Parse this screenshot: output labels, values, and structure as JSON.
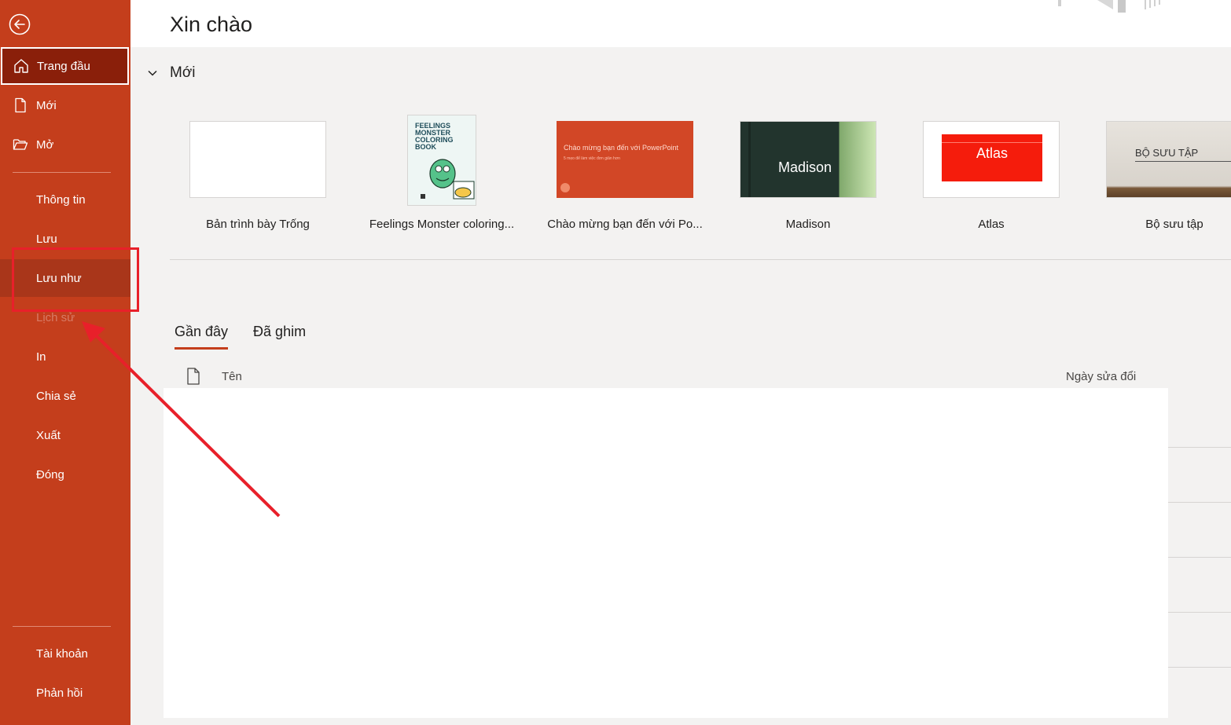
{
  "sidebar": {
    "items": [
      {
        "label": "Trang đầu",
        "icon": "home-icon",
        "state": "active"
      },
      {
        "label": "Mới",
        "icon": "new-document-icon"
      },
      {
        "label": "Mở",
        "icon": "open-folder-icon"
      },
      {
        "label": "Thông tin"
      },
      {
        "label": "Lưu"
      },
      {
        "label": "Lưu như",
        "state": "highlighted"
      },
      {
        "label": "Lịch sử",
        "state": "disabled"
      },
      {
        "label": "In"
      },
      {
        "label": "Chia sẻ"
      },
      {
        "label": "Xuất"
      },
      {
        "label": "Đóng"
      },
      {
        "label": "Tài khoản"
      },
      {
        "label": "Phản hồi"
      }
    ]
  },
  "header": {
    "greeting": "Xin chào"
  },
  "new_section": {
    "title": "Mới",
    "templates": [
      {
        "label": "Bản trình bày Trống"
      },
      {
        "label": "Feelings Monster coloring...",
        "thumb_title": "FEELINGS MONSTER COLORING BOOK"
      },
      {
        "label": "Chào mừng bạn đến với Po...",
        "thumb_title": "Chào mừng bạn đến với PowerPoint",
        "thumb_subtitle": "5 mẹo để làm việc đơn giản hơn"
      },
      {
        "label": "Madison",
        "thumb_title": "Madison"
      },
      {
        "label": "Atlas",
        "thumb_title": "Atlas"
      },
      {
        "label": "Bộ sưu tập",
        "thumb_title": "BỘ SƯU TẬP"
      }
    ]
  },
  "recent": {
    "tabs": [
      "Gần đây",
      "Đã ghim"
    ],
    "active_tab": "Gần đây",
    "columns": {
      "name": "Tên",
      "date": "Ngày sửa đổi"
    }
  },
  "colors": {
    "sidebar_bg": "#c43e1c",
    "sidebar_active": "#8a1f0a",
    "accent": "#c43e1c",
    "annotation": "#e8202a"
  }
}
